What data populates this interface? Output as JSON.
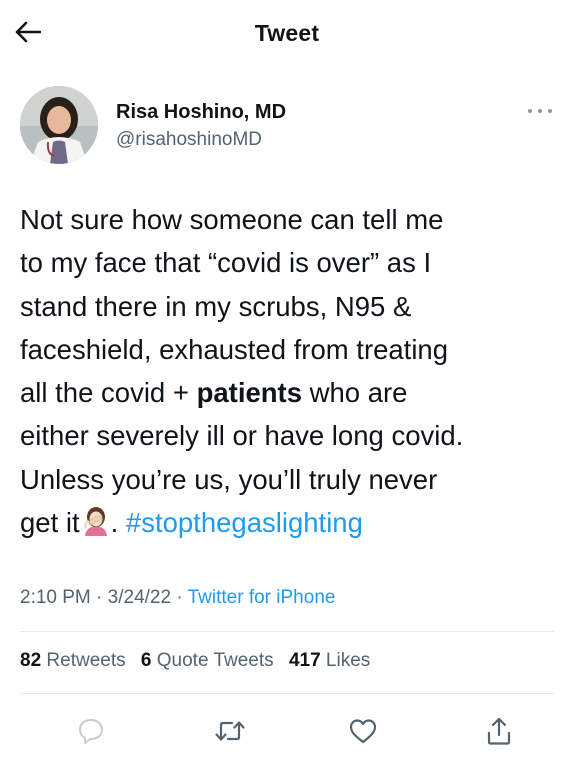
{
  "header": {
    "back_icon": "arrow-left-icon",
    "title": "Tweet"
  },
  "author": {
    "name": "Risa Hoshino, MD",
    "handle": "@risahoshinoMD",
    "more_icon": "more-horizontal-icon"
  },
  "tweet": {
    "lines": [
      "Not sure how someone can tell me",
      "to my face that “covid is over” as I",
      "stand there in my scrubs, N95 &",
      "faceshield, exhausted from treating"
    ],
    "line5_before": "all the covid + ",
    "line5_bold": "patients",
    "line5_after": " who are",
    "line6": "either severely ill or have long covid.",
    "line7": "Unless you’re us, you’ll truly never",
    "line8_before": "get it",
    "emoji_icon": "woman-facepalming-emoji-icon",
    "line8_after": ". ",
    "hashtag": "#stopthegaslighting"
  },
  "meta": {
    "time": "2:10 PM",
    "separator": " · ",
    "date": "3/24/22",
    "separator2": " · ",
    "source": "Twitter for iPhone"
  },
  "stats": {
    "retweets_count": "82",
    "retweets_label": " Retweets",
    "quotes_count": "6",
    "quotes_label": " Quote Tweets",
    "likes_count": "417",
    "likes_label": " Likes"
  },
  "actions": {
    "reply_icon": "reply-icon",
    "retweet_icon": "retweet-icon",
    "like_icon": "heart-icon",
    "share_icon": "share-icon"
  },
  "colors": {
    "text": "#0f1419",
    "secondary": "#536471",
    "link": "#1d9bf0",
    "divider": "#e7e9ea"
  }
}
